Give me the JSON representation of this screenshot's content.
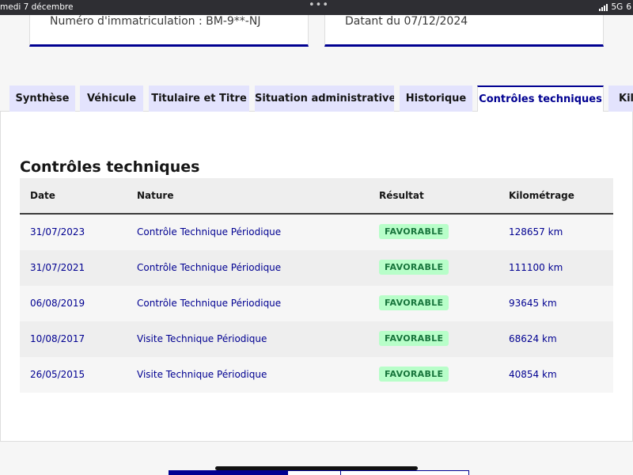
{
  "status_bar": {
    "time": "medi 7 décembre",
    "dots": "•••",
    "network": "5G",
    "battery": "6"
  },
  "cards": {
    "left_text": "Numéro d'immatriculation : BM-9**-NJ",
    "right_text": "Datant du 07/12/2024"
  },
  "tabs": [
    {
      "label": "Synthèse",
      "active": false
    },
    {
      "label": "Véhicule",
      "active": false
    },
    {
      "label": "Titulaire et Titre",
      "active": false
    },
    {
      "label": "Situation administrative",
      "active": false
    },
    {
      "label": "Historique",
      "active": false
    },
    {
      "label": "Contrôles techniques",
      "active": true
    },
    {
      "label": "Kilo",
      "active": false
    }
  ],
  "section": {
    "title": "Contrôles techniques"
  },
  "table": {
    "headers": [
      "Date",
      "Nature",
      "Résultat",
      "Kilométrage"
    ],
    "rows": [
      {
        "date": "31/07/2023",
        "nature": "Contrôle Technique Périodique",
        "result": "FAVORABLE",
        "km": "128657 km"
      },
      {
        "date": "31/07/2021",
        "nature": "Contrôle Technique Périodique",
        "result": "FAVORABLE",
        "km": "111100 km"
      },
      {
        "date": "06/08/2019",
        "nature": "Contrôle Technique Périodique",
        "result": "FAVORABLE",
        "km": "93645 km"
      },
      {
        "date": "10/08/2017",
        "nature": "Visite Technique Périodique",
        "result": "FAVORABLE",
        "km": "68624 km"
      },
      {
        "date": "26/05/2015",
        "nature": "Visite Technique Périodique",
        "result": "FAVORABLE",
        "km": "40854 km"
      }
    ]
  },
  "colors": {
    "accent": "#000091",
    "tab_bg": "#e3e3fd",
    "badge_bg": "#b8fec9",
    "badge_text": "#18753c"
  }
}
